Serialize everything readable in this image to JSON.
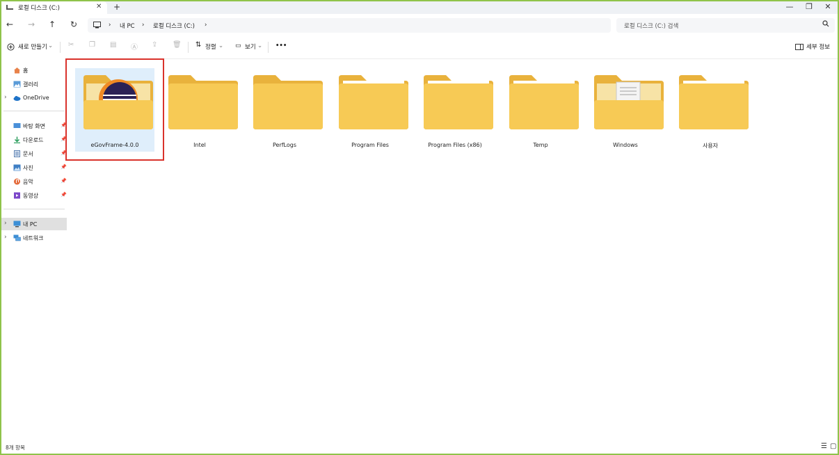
{
  "tab": {
    "title": "로컬 디스크 (C:)",
    "close": "✕",
    "new": "+"
  },
  "window_controls": {
    "minimize": "—",
    "maximize": "❐",
    "close": "✕"
  },
  "nav": {
    "back": "←",
    "forward": "→",
    "up": "↑",
    "refresh": "↻"
  },
  "breadcrumb": {
    "sep1": "›",
    "pc": "내 PC",
    "sep2": "›",
    "drive": "로컬 디스크 (C:)",
    "sep3": "›"
  },
  "search": {
    "placeholder": "로컬 디스크 (C:) 검색"
  },
  "toolbar": {
    "new_label": "새로 만들기",
    "sort_label": "정렬",
    "view_label": "보기",
    "more": "•••",
    "details_label": "세부 정보"
  },
  "sidebar": {
    "items": [
      {
        "label": "홈"
      },
      {
        "label": "갤러리"
      },
      {
        "label": "OneDrive"
      },
      {
        "label": "바탕 화면"
      },
      {
        "label": "다운로드"
      },
      {
        "label": "문서"
      },
      {
        "label": "사진"
      },
      {
        "label": "음악"
      },
      {
        "label": "동영상"
      },
      {
        "label": "내 PC"
      },
      {
        "label": "네트워크"
      }
    ]
  },
  "folders": [
    {
      "name": "eGovFrame-4.0.0",
      "selected": true
    },
    {
      "name": "Intel"
    },
    {
      "name": "PerfLogs"
    },
    {
      "name": "Program Files"
    },
    {
      "name": "Program Files (x86)"
    },
    {
      "name": "Temp"
    },
    {
      "name": "Windows"
    },
    {
      "name": "사용자"
    }
  ],
  "status": {
    "count": "8개 항목"
  },
  "colors": {
    "selection": "#dfeefb",
    "highlight_box": "#d9322b",
    "folder": "#f5c84e"
  }
}
